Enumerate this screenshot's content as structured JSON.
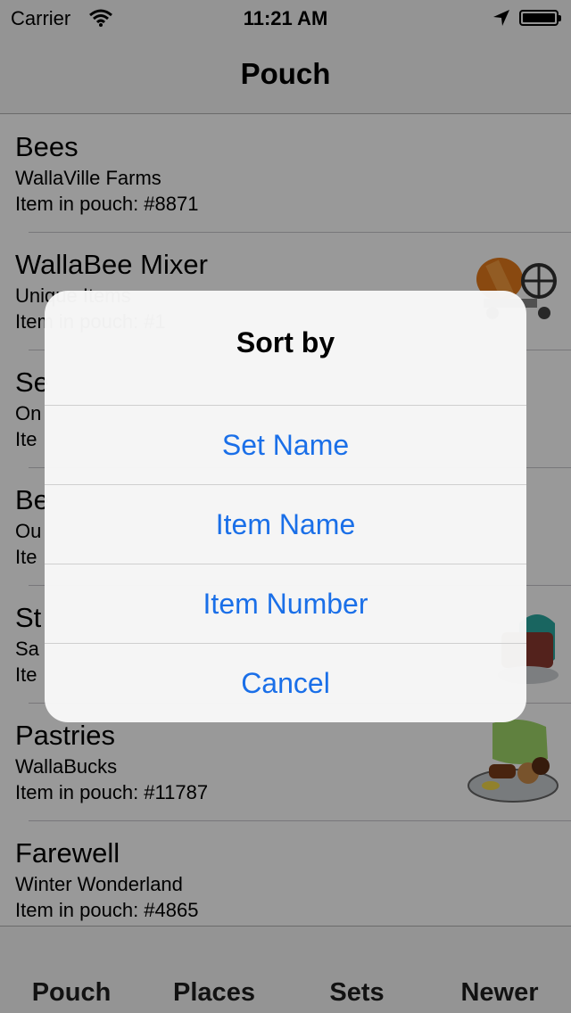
{
  "status_bar": {
    "carrier": "Carrier",
    "time": "11:21 AM"
  },
  "nav": {
    "title": "Pouch"
  },
  "items": [
    {
      "name": "Bees",
      "set": "WallaVille Farms",
      "pouch": "Item in pouch: #8871",
      "has_image": false
    },
    {
      "name": "WallaBee Mixer",
      "set": "Unique Items",
      "pouch": "Item in pouch: #1",
      "has_image": true
    },
    {
      "name": "Se",
      "set": "On",
      "pouch": "Ite",
      "has_image": false
    },
    {
      "name": "Be",
      "set": "Ou",
      "pouch": "Ite",
      "has_image": false
    },
    {
      "name": "St",
      "set": "Sa",
      "pouch": "Ite",
      "has_image": true
    },
    {
      "name": "Pastries",
      "set": "WallaBucks",
      "pouch": "Item in pouch: #11787",
      "has_image": true
    },
    {
      "name": "Farewell",
      "set": "Winter Wonderland",
      "pouch": "Item in pouch: #4865",
      "has_image": false
    }
  ],
  "tabs": [
    "Pouch",
    "Places",
    "Sets",
    "Newer"
  ],
  "alert": {
    "title": "Sort by",
    "buttons": [
      "Set Name",
      "Item Name",
      "Item Number",
      "Cancel"
    ]
  },
  "colors": {
    "accent": "#1a6fe8",
    "dim_overlay": "rgba(0,0,0,0.4)"
  }
}
